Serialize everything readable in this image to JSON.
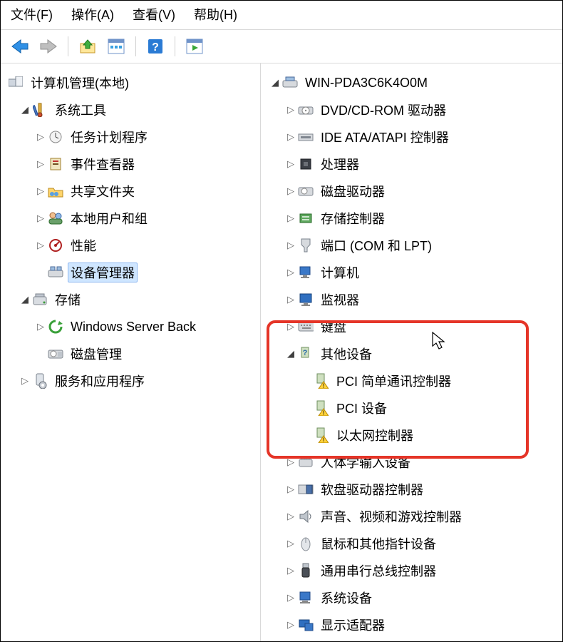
{
  "menubar": {
    "file": "文件(F)",
    "action": "操作(A)",
    "view": "查看(V)",
    "help": "帮助(H)"
  },
  "toolbar_icons": {
    "back": "back-arrow",
    "forward": "forward-arrow",
    "up": "folder-up",
    "properties": "window-grid",
    "help": "help",
    "refresh": "window-play"
  },
  "left_tree": {
    "root": "计算机管理(本地)",
    "system_tools": "系统工具",
    "task_scheduler": "任务计划程序",
    "event_viewer": "事件查看器",
    "shared_folders": "共享文件夹",
    "local_users_groups": "本地用户和组",
    "performance": "性能",
    "device_manager": "设备管理器",
    "storage": "存储",
    "wsb": "Windows Server Back",
    "disk_mgmt": "磁盘管理",
    "services_apps": "服务和应用程序"
  },
  "right_tree": {
    "root": "WIN-PDA3C6K4O0M",
    "dvd": "DVD/CD-ROM 驱动器",
    "ide": "IDE ATA/ATAPI 控制器",
    "cpu": "处理器",
    "diskdrv": "磁盘驱动器",
    "storage_ctrl": "存储控制器",
    "ports": "端口 (COM 和 LPT)",
    "computer": "计算机",
    "monitor": "监视器",
    "keyboard": "键盘",
    "other": "其他设备",
    "pci_comm": "PCI 简单通讯控制器",
    "pci_dev": "PCI 设备",
    "ethernet": "以太网控制器",
    "hid": "人体学输入设备",
    "floppy_ctrl": "软盘驱动器控制器",
    "sound": "声音、视频和游戏控制器",
    "mouse": "鼠标和其他指针设备",
    "usb": "通用串行总线控制器",
    "system_dev": "系统设备",
    "display": "显示适配器"
  }
}
